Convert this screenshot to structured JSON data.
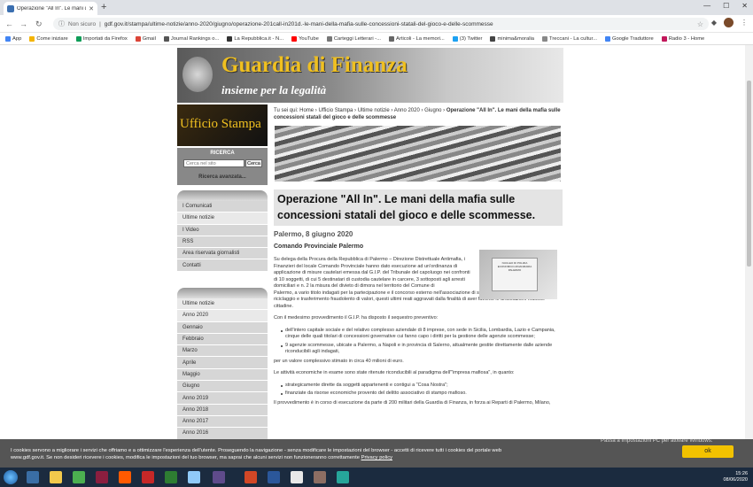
{
  "browser": {
    "tab_title": "Operazione \"All In\". Le mani del...",
    "security": "Non sicuro",
    "url": "gdf.gov.it/stampa/ultime-notizie/anno-2020/giugno/operazione-201call-in201d.-le-mani-della-mafia-sulle-concessioni-statali-del-gioco-e-delle-scommesse",
    "bookmarks": [
      "App",
      "Come iniziare",
      "Importati da Firefox",
      "Gmail",
      "Journal Rankings o...",
      "La Repubblica.it - N...",
      "YouTube",
      "Carteggi Letterari -...",
      "Articoli - La memori...",
      "(3) Twitter",
      "minima&moralia",
      "Treccani - La cultur...",
      "Google Traduttore",
      "Radio 3 - Home"
    ]
  },
  "header": {
    "site_title": "Guardia di Finanza",
    "motto": "insieme per la legalità",
    "section_title": "Ufficio Stampa"
  },
  "search": {
    "heading": "RICERCA",
    "placeholder": "Cerca nel sito",
    "button": "Cerca",
    "advanced": "Ricerca avanzata..."
  },
  "menu1": [
    "I Comunicati",
    "Ultime notizie",
    "I Video",
    "RSS",
    "Area riservata giornalisti",
    "Contatti"
  ],
  "menu2": [
    "Ultime notizie",
    "Anno 2020",
    "Gennaio",
    "Febbraio",
    "Marzo",
    "Aprile",
    "Maggio",
    "Giugno",
    "Anno 2019",
    "Anno 2018",
    "Anno 2017",
    "Anno 2016"
  ],
  "breadcrumb": {
    "prefix": "Tu sei qui: ",
    "links": [
      "Home",
      "Ufficio Stampa",
      "Ultime notizie",
      "Anno 2020",
      "Giugno"
    ],
    "sep": " › ",
    "current": "Operazione \"All In\". Le mani della mafia sulle concessioni statali del gioco e delle scommesse"
  },
  "article": {
    "title": "Operazione \"All In\". Le mani della mafia sulle concessioni statali del gioco e delle scommesse.",
    "date": "Palermo, 8 giugno 2020",
    "department": "Comando Provinciale Palermo",
    "plaque_text": "NUCLEO DI POLIZIA ECONOMICO-FINANZIARIA PALERMO",
    "p1": "Su delega della Procura della Repubblica di Palermo – Direzione Distrettuale Antimafia, i Finanzieri del locale Comando Provinciale hanno dato esecuzione ad un'ordinanza di applicazione di misure cautelari emessa dal G.I.P. del Tribunale del capoluogo nei confronti di 10 soggetti, di cui 5 destinatari di custodia cautelare in carcere, 3 sottoposti agli arresti domiciliari e n. 2 la misura del divieto di dimora nel territorio del Comune di",
    "p1b": "Palermo, a vario titolo indagati per la partecipazione e il concorso esterno nell'associazione di stampo mafioso \"Cosa nostra\", riciclaggio e trasferimento fraudolento di valori, questi ultimi reati aggravati dalla finalità di aver favorito le articolazioni mafiose cittadine.",
    "p2": "Con il medesimo provvedimento il G.I.P. ha disposto il sequestro preventivo:",
    "bullets1": [
      "dell'intero capitale sociale e del relativo complesso aziendale di 8 imprese, con sede in Sicilia, Lombardia, Lazio e Campania, cinque delle quali titolari di concessioni governative cui fanno capo i diritti per la gestione delle agenzie scommesse;",
      "9 agenzie scommesse, ubicate a Palermo, a Napoli e in provincia di Salerno, attualmente gestite direttamente dalle aziende riconducibili agli indagati,"
    ],
    "p3": "per un valore complessivo stimato in circa 40 milioni di euro.",
    "p4": "Le attività economiche in esame sono state ritenute riconducibili al paradigma dell'\"impresa mafiosa\", in quanto:",
    "bullets2": [
      "strategicamente dirette da soggetti appartenenti e contigui a \"Cosa Nostra\";",
      "finanziate da risorse economiche provento del delitto associativo di stampo mafioso."
    ],
    "p5": "Il provvedimento è in corso di esecuzione da parte di 200 militari della Guardia di Finanza, in forza ai Reparti di Palermo, Milano,"
  },
  "cookie": {
    "line1": "I cookies servono a migliorare i servizi che offriamo e a ottimizzare l'esperienza dell'utente. Proseguendo la navigazione - senza modificare le impostazioni del browser - accetti di ricevere tutti i cookies del portale web",
    "line2": "www.gdf.gov.it. Se non desideri ricevere i cookies, modifica le impostazioni del tuo browser, ma saprai che alcuni servizi non funzioneranno correttamente ",
    "link": "Privacy policy",
    "ok": "ok"
  },
  "watermark": {
    "title": "Attiva Windows",
    "subtitle": "Passa a Impostazioni PC per attivare Windows."
  },
  "taskbar": {
    "time": "15:26",
    "date": "08/06/2020"
  },
  "colors": {
    "gold": "#f0c020",
    "cookie_bg": "#555555",
    "ok_button": "#f2c200"
  }
}
